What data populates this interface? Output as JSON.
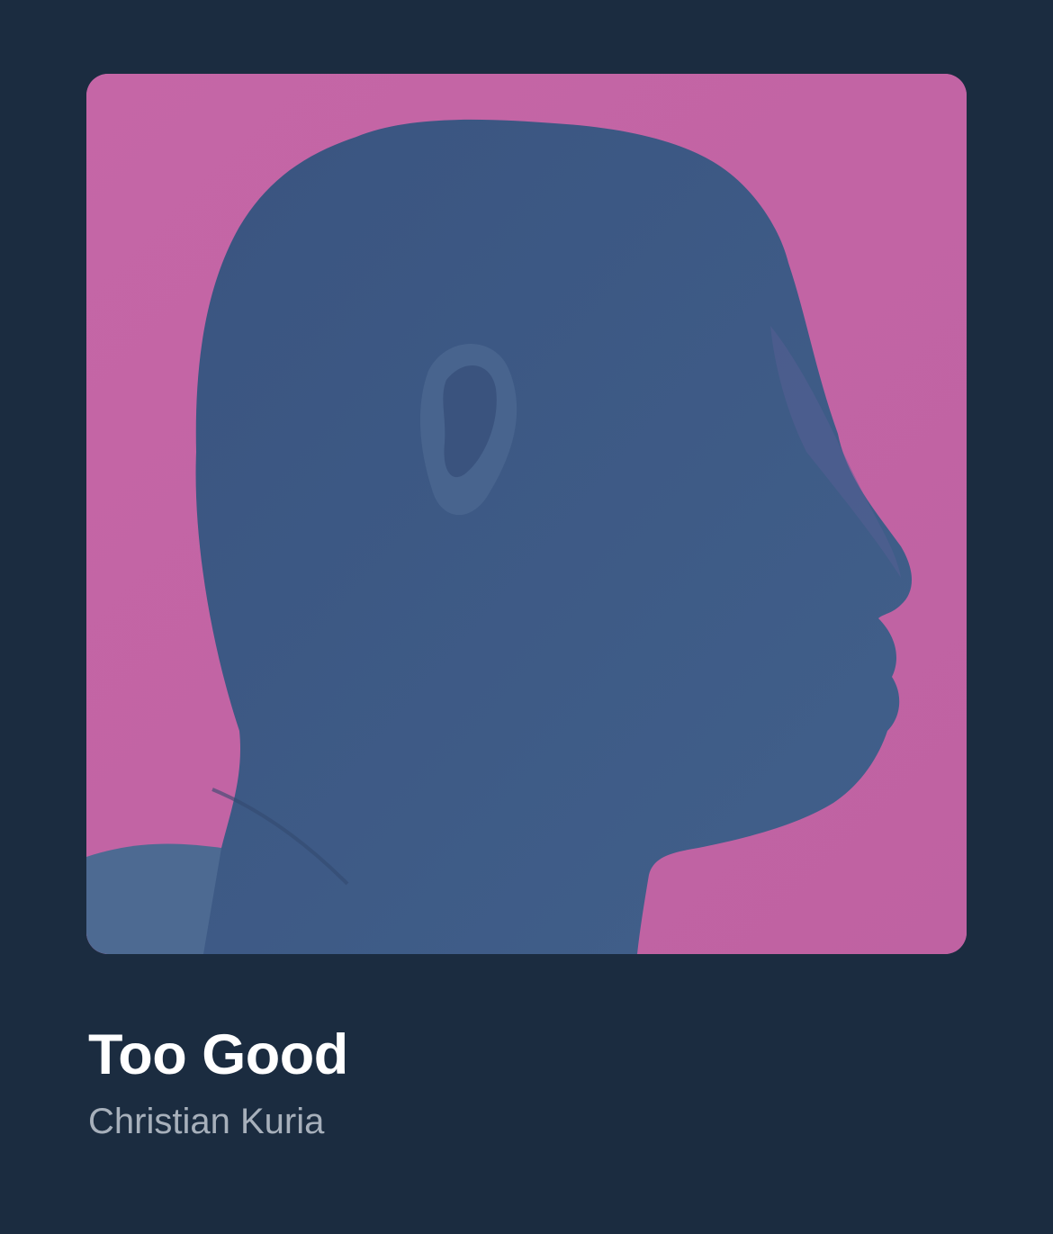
{
  "now_playing": {
    "title": "Too Good",
    "artist": "Christian Kuria",
    "artwork": {
      "background_color": "#c264a4",
      "silhouette_color": "#3f5b86"
    }
  },
  "colors": {
    "page_background": "#1b2c40",
    "title": "#ffffff",
    "artist": "#a7b0bb"
  }
}
